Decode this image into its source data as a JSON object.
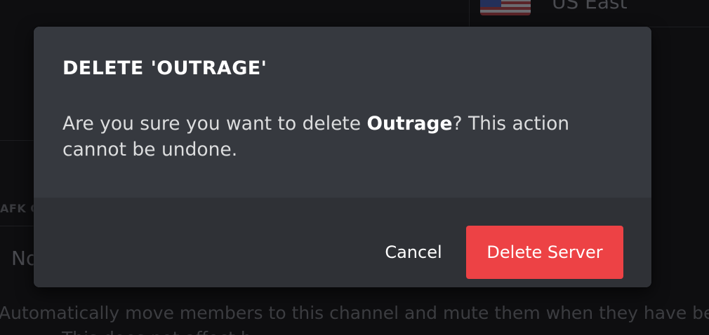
{
  "background": {
    "region_label": "US East",
    "afk_label": "AFK C",
    "select_value": "No",
    "help_text": "Automatically move members to this channel and mute them when they have been idle f",
    "help_text_line2": "This does not affect b"
  },
  "dialog": {
    "title": "DELETE 'OUTRAGE'",
    "message_prefix": "Are you sure you want to delete ",
    "server_name": "Outrage",
    "message_suffix": "? This action cannot be undone.",
    "cancel_label": "Cancel",
    "confirm_label": "Delete Server"
  },
  "colors": {
    "modal_background": "#36393f",
    "footer_background": "#2f3136",
    "danger_accent": "#ed4245"
  }
}
